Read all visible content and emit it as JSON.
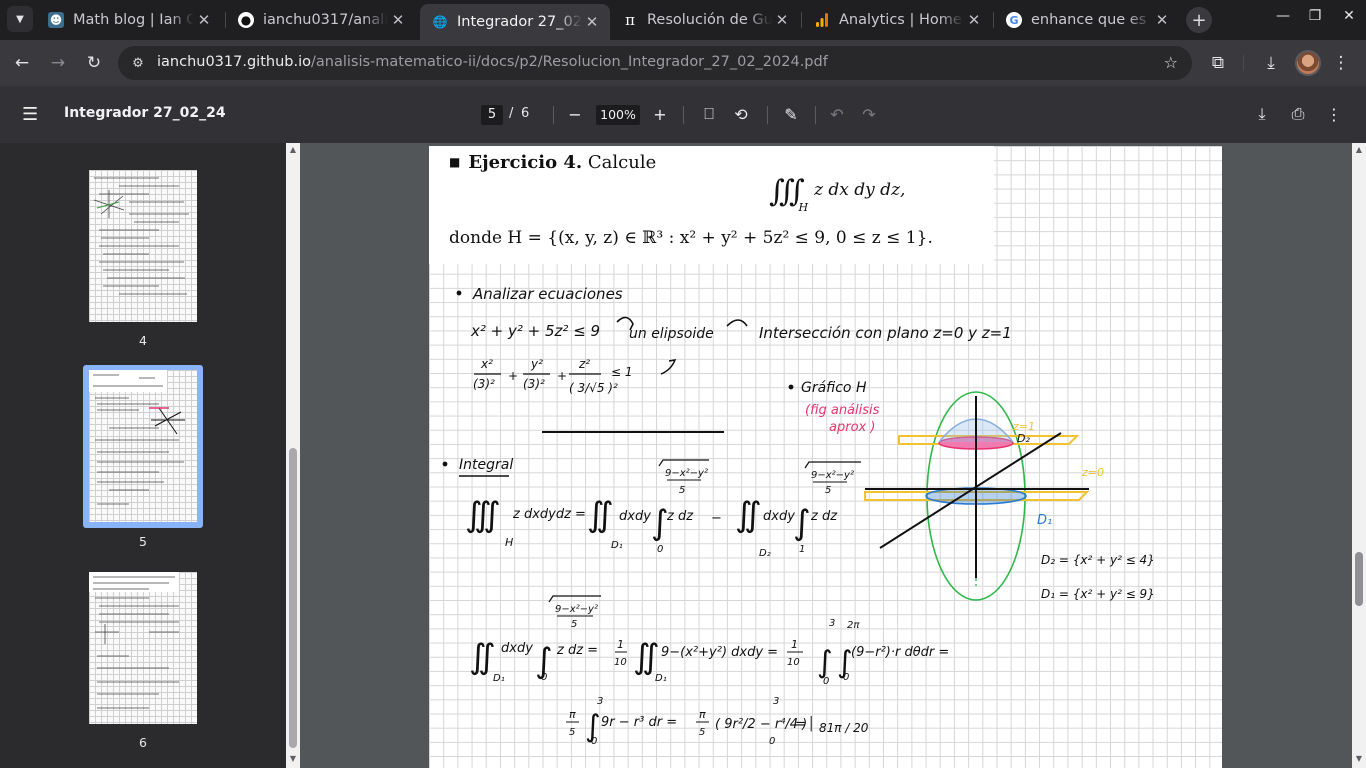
{
  "tabs": [
    {
      "title": "Math blog | Ian Ch",
      "icon": "avatar-favicon-icon",
      "active": false
    },
    {
      "title": "ianchu0317/analis",
      "icon": "github-icon",
      "active": false
    },
    {
      "title": "Integrador 27_02_",
      "icon": "globe-icon",
      "active": true
    },
    {
      "title": "Resolución de Gui",
      "icon": "pi-icon",
      "active": false
    },
    {
      "title": "Analytics | Home",
      "icon": "analytics-icon",
      "active": false
    },
    {
      "title": "enhance que es - G",
      "icon": "google-icon",
      "active": false
    }
  ],
  "address": {
    "host": "ianchu0317.github.io",
    "path": "/analisis-matematico-ii/docs/p2/Resolucion_Integrador_27_02_2024.pdf"
  },
  "pdf": {
    "title": "Integrador 27_02_24",
    "current_page": "5",
    "page_separator": "/",
    "total_pages": "6",
    "zoom": "100%"
  },
  "thumbnails": [
    {
      "label": "4"
    },
    {
      "label": "5",
      "selected": true
    },
    {
      "label": "6"
    }
  ],
  "document": {
    "exercise_title": "Ejercicio 4.",
    "exercise_verb": "Calcule",
    "integral_text": "z dx dy dz,",
    "integral_sub": "H",
    "domain_text": "donde H = {(x, y, z) ∈ ℝ³ :  x² + y² + 5z² ≤ 9,  0 ≤ z ≤ 1}.",
    "handwritten": {
      "analyze": "Analizar ecuaciones",
      "equation": "x² + y² + 5z² ≤ 9",
      "elipsoide": "un elipsoide",
      "interseccion": "Intersección con plano   z=0  y  z=1",
      "graph_title": "Gráfico H",
      "graph_note_1": "(fig análisis",
      "graph_note_2": "aprox )",
      "z1_label": "z=1",
      "z0_label": "z=0",
      "d2_label": "D₂",
      "d1_label": "D₁",
      "d2_def": "D₂ = {x² + y² ≤ 4}",
      "d1_def": "D₁ = {x² + y² ≤ 9}",
      "integral_label": "Integral",
      "result": "81π / 20"
    }
  },
  "colors": {
    "accent": "#8ab4f8",
    "ink": "#111111",
    "pink": "#e8336d",
    "yellow": "#f2c230",
    "green": "#2eb84a",
    "blue": "#2a7ad1"
  }
}
